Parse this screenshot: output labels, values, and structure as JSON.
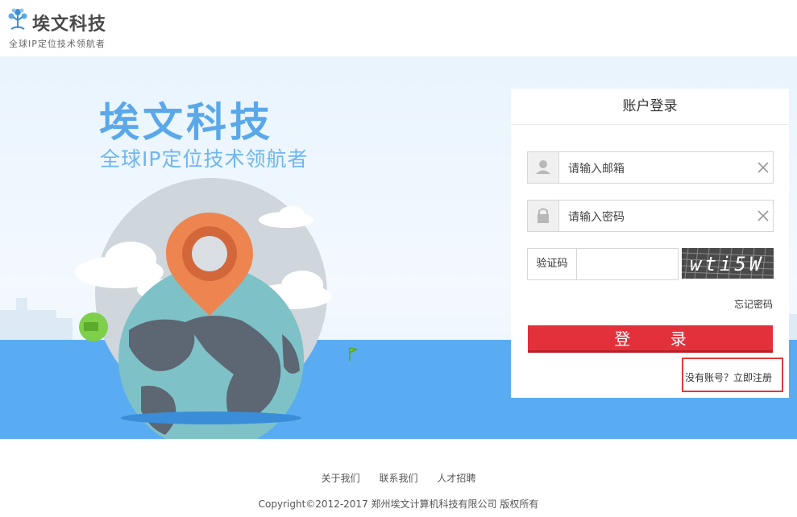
{
  "header": {
    "logo_title": "埃文科技",
    "logo_subtitle": "全球IP定位技术领航者"
  },
  "hero": {
    "title": "埃文科技",
    "subtitle": "全球IP定位技术领航者"
  },
  "login": {
    "title": "账户登录",
    "email_placeholder": "请输入邮箱",
    "password_placeholder": "请输入密码",
    "captcha_label": "验证码",
    "captcha_text": "wti5W",
    "forgot_password": "忘记密码",
    "submit_label": "登 录",
    "register_link": "没有账号？立即注册"
  },
  "footer": {
    "links": [
      "关于我们",
      "联系我们",
      "人才招聘"
    ],
    "copyright": "Copyright©2012-2017  郑州埃文计算机科技有限公司 版权所有"
  },
  "colors": {
    "brand_blue": "#5aa8ea",
    "login_button": "#e2313b",
    "highlight_border": "#e03a3a",
    "sea": "#5aacf2"
  },
  "icons": {
    "email_field": "user-icon",
    "password_field": "lock-icon",
    "clear": "close-icon"
  }
}
